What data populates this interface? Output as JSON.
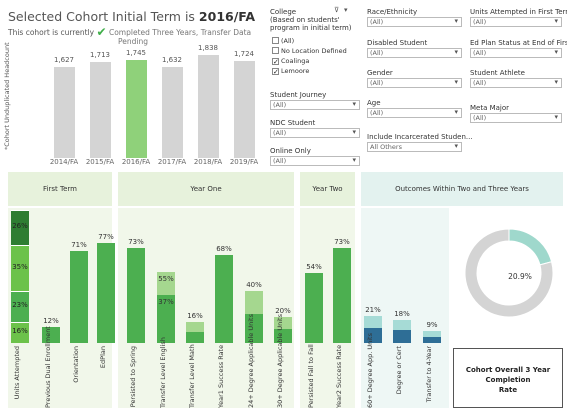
{
  "header": {
    "title_prefix": "Selected Cohort Initial Term is ",
    "title_term": "2016/FA",
    "subtitle_prefix": "This cohort is currently",
    "status_line1": "Completed Three Years, Transfer Data",
    "status_line2": "Pending",
    "y_axis_label": "*Cohort Unduplicated Headcount"
  },
  "top_chart": {
    "categories": [
      "2014/FA",
      "2015/FA",
      "2016/FA",
      "2017/FA",
      "2018/FA",
      "2019/FA"
    ],
    "values": [
      1627,
      1713,
      1745,
      1632,
      1838,
      1724
    ],
    "value_labels": [
      "1,627",
      "1,713",
      "1,745",
      "1,632",
      "1,838",
      "1,724"
    ],
    "highlight_index": 2,
    "highlight_color": "#8fd17a",
    "bar_color": "#d4d4d4"
  },
  "filters": {
    "college": {
      "label": "College",
      "sublabel1": "(Based on students'",
      "sublabel2": "program in initial term)",
      "options": [
        {
          "label": "(All)",
          "checked": false
        },
        {
          "label": "No Location Defined",
          "checked": false
        },
        {
          "label": "Coalinga",
          "checked": true
        },
        {
          "label": "Lemoore",
          "checked": true
        }
      ]
    },
    "race": {
      "label": "Race/Ethnicity",
      "value": "(All)"
    },
    "units": {
      "label": "Units Attempted in First Term",
      "value": "(All)"
    },
    "disabled": {
      "label": "Disabled Student",
      "value": "(All)"
    },
    "edplan": {
      "label": "Ed Plan Status at End of First...",
      "value": "(All)"
    },
    "gender": {
      "label": "Gender",
      "value": "(All)"
    },
    "athlete": {
      "label": "Student Athlete",
      "value": "(All)"
    },
    "journey": {
      "label": "Student Journey",
      "value": "(All)"
    },
    "age": {
      "label": "Age",
      "value": "(All)"
    },
    "meta": {
      "label": "Meta Major",
      "value": "(All)"
    },
    "ndc": {
      "label": "NDC Student",
      "value": "(All)"
    },
    "incarcerated": {
      "label": "Include Incarcerated Studen...",
      "value": "All Others"
    },
    "online": {
      "label": "Online Only",
      "value": "(All)"
    }
  },
  "sections": {
    "first_term": "First Term",
    "year_one": "Year One",
    "year_two": "Year Two",
    "outcomes": "Outcomes Within Two and Three Years"
  },
  "chart_data": {
    "type": "bar",
    "categories": [
      "Units Attempted",
      "Previous Dual Enrollment",
      "Orientation",
      "EdPlan",
      "Persisted to Spring",
      "Transfer Level English",
      "Transfer Level Math",
      "Year1 Success Rate",
      "24+ Degree Applicable Units",
      "30+ Degree Applicable Units",
      "Persisted Fall to Fall",
      "Year2 Success Rate",
      "60+ Degree App. Units",
      "Degree or Cert",
      "Transfer to 4-Year"
    ],
    "units_attempted_segments": [
      16,
      23,
      35,
      26
    ],
    "values": [
      null,
      12,
      71,
      77,
      73,
      55,
      16,
      68,
      40,
      20,
      54,
      73,
      21,
      18,
      9
    ],
    "inner_values": {
      "Transfer Level English": 37
    },
    "value_labels": {
      "Previous Dual Enrollment": "12%",
      "Orientation": "71%",
      "EdPlan": "77%",
      "Persisted to Spring": "73%",
      "Transfer Level English": "55%",
      "Transfer Level English inner": "37%",
      "Transfer Level Math": "16%",
      "Year1 Success Rate": "68%",
      "24+ Degree Applicable Units": "40%",
      "30+ Degree Applicable Units": "20%",
      "Persisted Fall to Fall": "54%",
      "Year2 Success Rate": "73%",
      "60+ Degree App. Units": "21%",
      "Degree or Cert": "18%",
      "Transfer to 4-Year": "9%"
    },
    "segment_labels": [
      "16%",
      "23%",
      "35%",
      "26%"
    ],
    "ylim": [
      0,
      100
    ]
  },
  "pie": {
    "value": 20.9,
    "label": "20.9%",
    "color_value": "#9fd8cc",
    "color_rest": "#d4d4d4"
  },
  "kpi": {
    "line1": "Cohort Overall 3 Year Completion",
    "line2": "Rate"
  },
  "colors": {
    "green_dark": "#2e7d32",
    "green": "#4caf50",
    "green_mid": "#6cc24a",
    "green_light": "#a5d78f",
    "teal_dark": "#2e6e96",
    "teal_light": "#a6dbd6"
  }
}
